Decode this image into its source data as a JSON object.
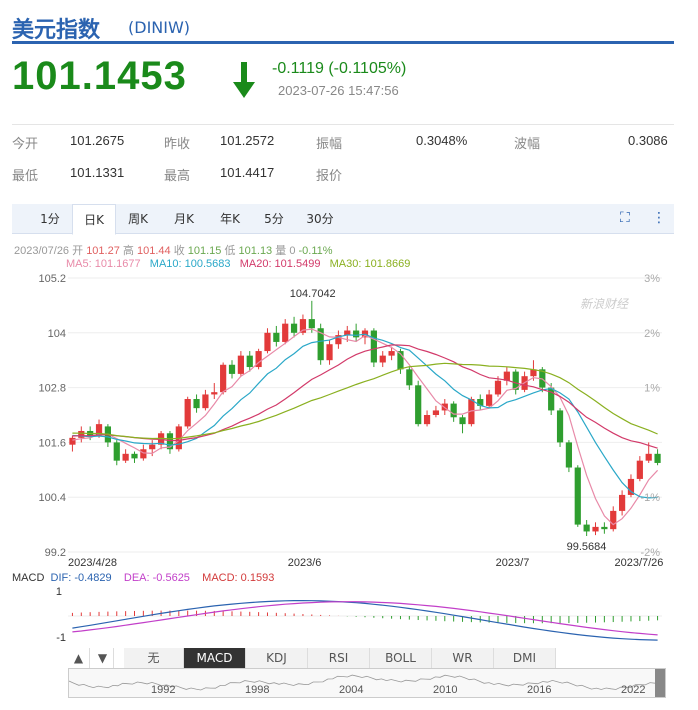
{
  "header": {
    "title": "美元指数",
    "code": "(DINIW)"
  },
  "quote": {
    "price": "101.1453",
    "change": "-0.1119 (-0.1105%)",
    "timestamp": "2023-07-26 15:47:56",
    "color_down": "#1a8a1a"
  },
  "stats": [
    {
      "label": "今开",
      "value": "101.2675"
    },
    {
      "label": "昨收",
      "value": "101.2572"
    },
    {
      "label": "振幅",
      "value": "0.3048%"
    },
    {
      "label": "波幅",
      "value": "0.3086"
    },
    {
      "label": "最低",
      "value": "101.1331"
    },
    {
      "label": "最高",
      "value": "101.4417"
    },
    {
      "label": "报价",
      "value": ""
    }
  ],
  "tabs": [
    "1分",
    "日K",
    "周K",
    "月K",
    "年K",
    "5分",
    "30分"
  ],
  "active_tab": "日K",
  "info_line": {
    "date": "2023/07/26",
    "items": [
      {
        "label": "开",
        "value": "101.27"
      },
      {
        "label": "高",
        "value": "101.44"
      },
      {
        "label": "收",
        "value": "101.15"
      },
      {
        "label": "低",
        "value": "101.13"
      },
      {
        "label": "量",
        "value": "0"
      },
      {
        "label": "",
        "value": "-0.11%"
      }
    ]
  },
  "ma_legend": [
    {
      "label": "MA5: 101.1677",
      "color": "#e88aa8"
    },
    {
      "label": "MA10: 100.5683",
      "color": "#2aa8c8"
    },
    {
      "label": "MA20: 101.5499",
      "color": "#d23a6a"
    },
    {
      "label": "MA30: 101.8669",
      "color": "#8ab020"
    }
  ],
  "macd_legend": {
    "title": "MACD",
    "dif": "DIF: -0.4829",
    "dea": "DEA: -0.5625",
    "macd": "MACD: 0.1593"
  },
  "indicator_tabs": [
    "无",
    "MACD",
    "KDJ",
    "RSI",
    "BOLL",
    "WR",
    "DMI"
  ],
  "active_indicator": "MACD",
  "navigator_years": [
    "1992",
    "1998",
    "2004",
    "2010",
    "2016",
    "2022"
  ],
  "watermark": "新浪财经",
  "chart_data": {
    "type": "candlestick",
    "y_ticks": [
      "105.2",
      "104",
      "102.8",
      "101.6",
      "100.4",
      "99.2"
    ],
    "y_range": [
      99.2,
      105.2
    ],
    "pct_ticks": [
      "3%",
      "2%",
      "1%",
      "",
      "-1%",
      "-2%"
    ],
    "x_labels": [
      "2023/4/28",
      "2023/6",
      "2023/7",
      "2023/7/26"
    ],
    "annotations": {
      "high": "104.7042",
      "low": "99.5684"
    },
    "macd_ticks": [
      "1",
      "-1"
    ],
    "candles": [
      [
        101.55,
        101.7,
        101.4,
        101.75
      ],
      [
        101.7,
        101.85,
        101.6,
        101.95
      ],
      [
        101.85,
        101.75,
        101.65,
        101.95
      ],
      [
        101.75,
        102.0,
        101.7,
        102.1
      ],
      [
        101.95,
        101.6,
        101.5,
        102.0
      ],
      [
        101.6,
        101.2,
        101.1,
        101.65
      ],
      [
        101.2,
        101.35,
        101.15,
        101.45
      ],
      [
        101.35,
        101.25,
        101.15,
        101.4
      ],
      [
        101.25,
        101.45,
        101.2,
        101.55
      ],
      [
        101.45,
        101.55,
        101.3,
        101.65
      ],
      [
        101.55,
        101.8,
        101.45,
        101.85
      ],
      [
        101.8,
        101.45,
        101.35,
        101.85
      ],
      [
        101.45,
        101.95,
        101.4,
        102.0
      ],
      [
        101.95,
        102.55,
        101.9,
        102.6
      ],
      [
        102.55,
        102.35,
        102.25,
        102.65
      ],
      [
        102.35,
        102.65,
        102.3,
        102.75
      ],
      [
        102.65,
        102.7,
        102.55,
        102.9
      ],
      [
        102.7,
        103.3,
        102.65,
        103.35
      ],
      [
        103.3,
        103.1,
        103.0,
        103.4
      ],
      [
        103.1,
        103.5,
        103.05,
        103.6
      ],
      [
        103.5,
        103.25,
        103.15,
        103.6
      ],
      [
        103.25,
        103.6,
        103.2,
        103.65
      ],
      [
        103.6,
        104.0,
        103.55,
        104.1
      ],
      [
        104.0,
        103.8,
        103.7,
        104.15
      ],
      [
        103.8,
        104.2,
        103.75,
        104.3
      ],
      [
        104.2,
        104.0,
        103.9,
        104.35
      ],
      [
        104.0,
        104.3,
        103.95,
        104.4
      ],
      [
        104.3,
        104.1,
        104.0,
        104.7
      ],
      [
        104.1,
        103.4,
        103.3,
        104.2
      ],
      [
        103.4,
        103.75,
        103.3,
        103.85
      ],
      [
        103.75,
        103.95,
        103.65,
        104.05
      ],
      [
        103.95,
        104.05,
        103.8,
        104.15
      ],
      [
        104.05,
        103.9,
        103.8,
        104.2
      ],
      [
        103.9,
        104.05,
        103.75,
        104.1
      ],
      [
        104.05,
        103.35,
        103.25,
        104.1
      ],
      [
        103.35,
        103.5,
        103.25,
        103.6
      ],
      [
        103.5,
        103.6,
        103.4,
        103.7
      ],
      [
        103.6,
        103.2,
        103.1,
        103.65
      ],
      [
        103.2,
        102.85,
        102.75,
        103.25
      ],
      [
        102.85,
        102.0,
        101.95,
        102.95
      ],
      [
        102.0,
        102.2,
        101.95,
        102.3
      ],
      [
        102.2,
        102.3,
        102.15,
        102.4
      ],
      [
        102.3,
        102.45,
        102.2,
        102.55
      ],
      [
        102.45,
        102.15,
        102.05,
        102.5
      ],
      [
        102.15,
        102.0,
        101.8,
        102.2
      ],
      [
        102.0,
        102.55,
        101.95,
        102.6
      ],
      [
        102.55,
        102.4,
        102.3,
        102.65
      ],
      [
        102.4,
        102.65,
        102.35,
        102.75
      ],
      [
        102.65,
        102.95,
        102.6,
        103.05
      ],
      [
        102.95,
        103.15,
        102.85,
        103.25
      ],
      [
        103.15,
        102.75,
        102.65,
        103.2
      ],
      [
        102.75,
        103.05,
        102.7,
        103.15
      ],
      [
        103.05,
        103.2,
        102.95,
        103.4
      ],
      [
        103.2,
        102.8,
        102.7,
        103.25
      ],
      [
        102.8,
        102.3,
        102.2,
        102.9
      ],
      [
        102.3,
        101.6,
        101.5,
        102.35
      ],
      [
        101.6,
        101.05,
        100.95,
        101.65
      ],
      [
        101.05,
        99.8,
        99.75,
        101.1
      ],
      [
        99.8,
        99.65,
        99.55,
        99.9
      ],
      [
        99.65,
        99.75,
        99.57,
        99.85
      ],
      [
        99.75,
        99.7,
        99.6,
        99.85
      ],
      [
        99.7,
        100.1,
        99.65,
        100.2
      ],
      [
        100.1,
        100.45,
        100.0,
        100.55
      ],
      [
        100.45,
        100.8,
        100.4,
        100.9
      ],
      [
        100.8,
        101.2,
        100.75,
        101.3
      ],
      [
        101.2,
        101.35,
        101.15,
        101.6
      ],
      [
        101.35,
        101.15,
        101.1,
        101.45
      ]
    ]
  }
}
